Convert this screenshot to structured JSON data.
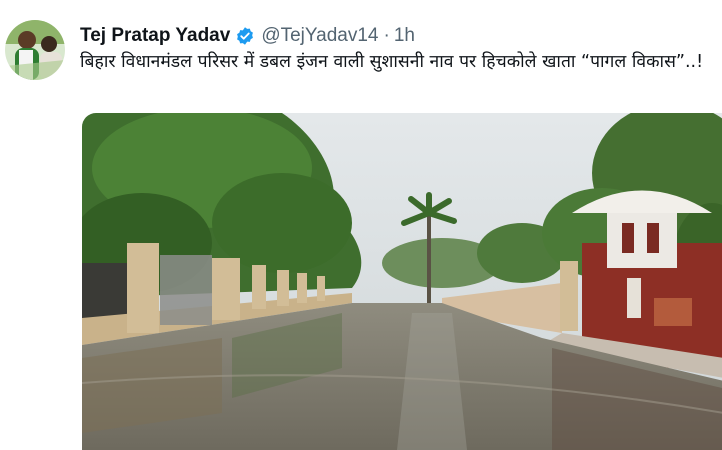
{
  "tweet": {
    "display_name": "Tej Pratap Yadav",
    "handle": "@TejYadav14",
    "separator": "·",
    "timestamp": "1h",
    "text": "बिहार विधानमंडल परिसर में डबल इंजन वाली सुशासनी नाव पर हिचकोले खाता “पागल विकास”..!",
    "verified_icon": "verified-badge-icon",
    "colors": {
      "name": "#0f1419",
      "meta": "#536471",
      "verified": "#1d9bf0"
    }
  }
}
